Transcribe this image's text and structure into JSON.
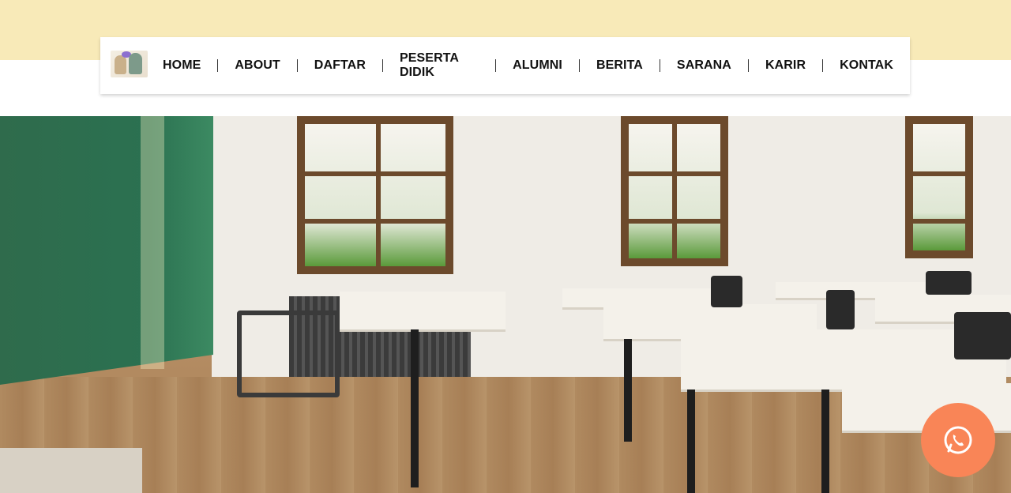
{
  "header": {
    "logo_alt": "",
    "menu": [
      {
        "label": "HOME"
      },
      {
        "label": "ABOUT"
      },
      {
        "label": "DAFTAR"
      },
      {
        "label": "PESERTA DIDIK"
      },
      {
        "label": "ALUMNI"
      },
      {
        "label": "BERITA"
      },
      {
        "label": "SARANA"
      },
      {
        "label": "KARIR"
      },
      {
        "label": "KONTAK"
      }
    ]
  },
  "hero": {
    "image": "classroom-photo"
  },
  "floating": {
    "icon": "whatsapp-icon"
  },
  "colors": {
    "top_band": "#f8eab8",
    "whatsapp_button": "#f98557",
    "nav_text": "#111111"
  }
}
